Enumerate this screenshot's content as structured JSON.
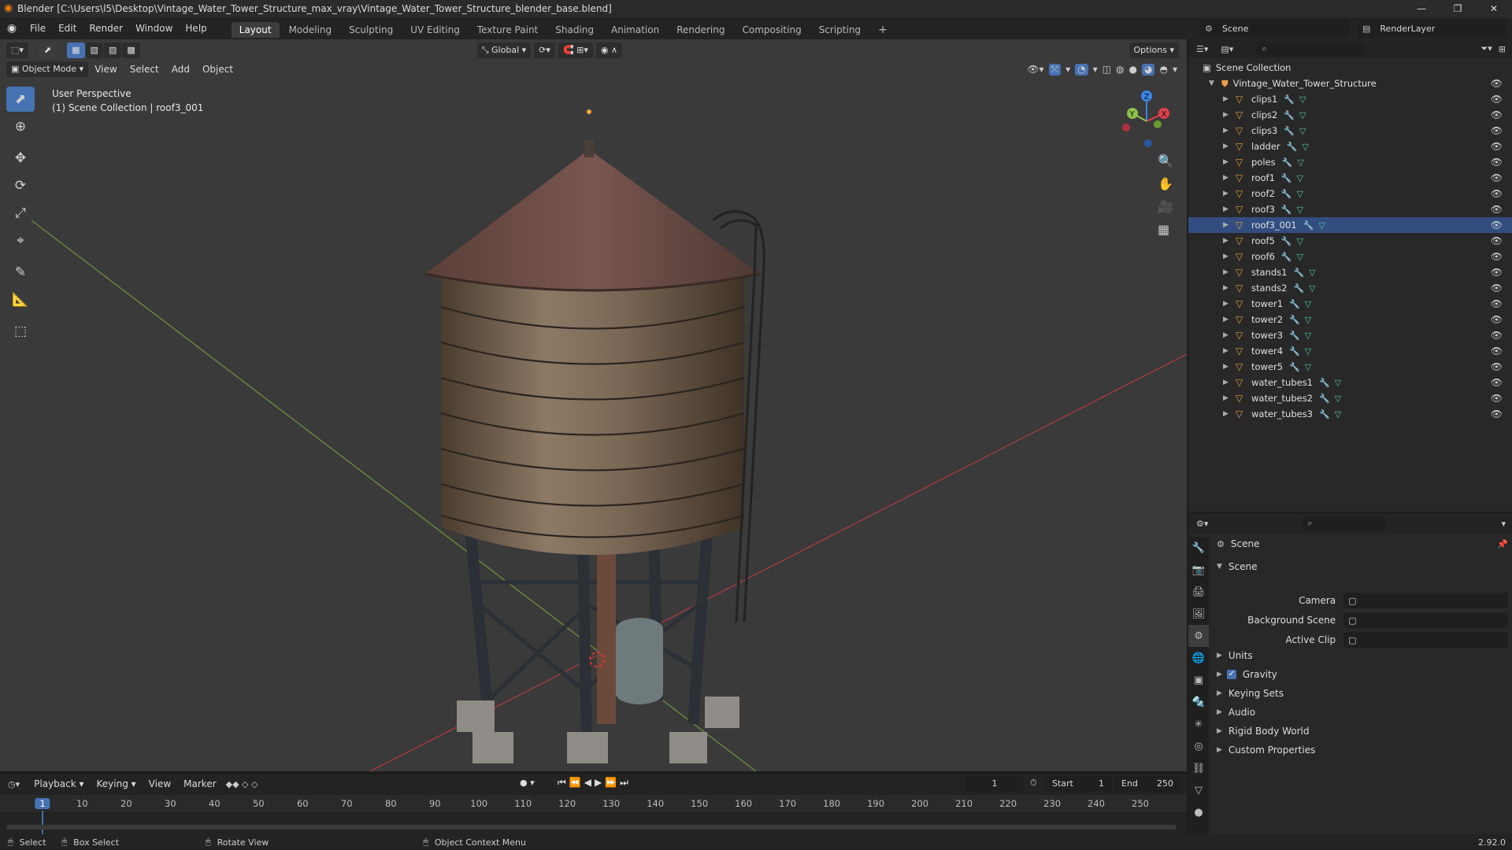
{
  "window": {
    "title": "Blender [C:\\Users\\l5\\Desktop\\Vintage_Water_Tower_Structure_max_vray\\Vintage_Water_Tower_Structure_blender_base.blend]",
    "controls": [
      "—",
      "❐",
      "✕"
    ]
  },
  "menu": [
    "File",
    "Edit",
    "Render",
    "Window",
    "Help"
  ],
  "workspaces": [
    {
      "label": "Layout",
      "active": true
    },
    {
      "label": "Modeling"
    },
    {
      "label": "Sculpting"
    },
    {
      "label": "UV Editing"
    },
    {
      "label": "Texture Paint"
    },
    {
      "label": "Shading"
    },
    {
      "label": "Animation"
    },
    {
      "label": "Rendering"
    },
    {
      "label": "Compositing"
    },
    {
      "label": "Scripting"
    }
  ],
  "scene_selector": {
    "scene": "Scene",
    "view_layer": "RenderLayer"
  },
  "viewport": {
    "mode": "Object Mode",
    "menus": [
      "View",
      "Select",
      "Add",
      "Object"
    ],
    "transform_orientation": "Global",
    "options_label": "Options",
    "info_line1": "User Perspective",
    "info_line2": "(1) Scene Collection | roof3_001",
    "gizmo_axes": {
      "z": "Z",
      "y": "Y",
      "x": "X"
    }
  },
  "outliner": {
    "root": "Scene Collection",
    "collection": "Vintage_Water_Tower_Structure",
    "items": [
      {
        "name": "clips1"
      },
      {
        "name": "clips2"
      },
      {
        "name": "clips3"
      },
      {
        "name": "ladder"
      },
      {
        "name": "poles"
      },
      {
        "name": "roof1"
      },
      {
        "name": "roof2"
      },
      {
        "name": "roof3"
      },
      {
        "name": "roof3_001",
        "selected": true
      },
      {
        "name": "roof5"
      },
      {
        "name": "roof6"
      },
      {
        "name": "stands1"
      },
      {
        "name": "stands2"
      },
      {
        "name": "tower1"
      },
      {
        "name": "tower2"
      },
      {
        "name": "tower3"
      },
      {
        "name": "tower4"
      },
      {
        "name": "tower5"
      },
      {
        "name": "water_tubes1"
      },
      {
        "name": "water_tubes2"
      },
      {
        "name": "water_tubes3"
      }
    ]
  },
  "properties": {
    "context": "Scene",
    "panel": "Scene",
    "fields": [
      {
        "label": "Camera",
        "value": ""
      },
      {
        "label": "Background Scene",
        "value": ""
      },
      {
        "label": "Active Clip",
        "value": ""
      }
    ],
    "subpanels": [
      "Units",
      "Gravity",
      "Keying Sets",
      "Audio",
      "Rigid Body World",
      "Custom Properties"
    ],
    "gravity_checked": true
  },
  "timeline": {
    "menus": [
      "Playback",
      "Keying",
      "View",
      "Marker"
    ],
    "current_frame": "1",
    "start_label": "Start",
    "start": "1",
    "end_label": "End",
    "end": "250",
    "ticks": [
      "1",
      "10",
      "20",
      "30",
      "40",
      "50",
      "60",
      "70",
      "80",
      "90",
      "100",
      "110",
      "120",
      "130",
      "140",
      "150",
      "160",
      "170",
      "180",
      "190",
      "200",
      "210",
      "220",
      "230",
      "240",
      "250"
    ]
  },
  "statusbar": {
    "items": [
      "Select",
      "Box Select",
      "Rotate View",
      "Object Context Menu"
    ],
    "version": "2.92.0"
  },
  "colors": {
    "accent": "#4772b3",
    "selected_row": "#334d80",
    "mesh_icon": "#e89b3b",
    "axis_x": "#e0404a",
    "axis_y": "#8bc34a",
    "axis_z": "#3a86e8"
  }
}
